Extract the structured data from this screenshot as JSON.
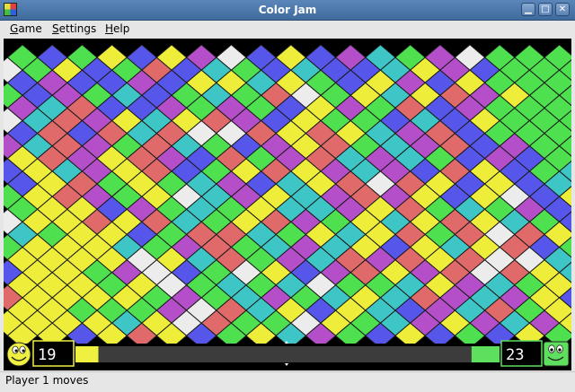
{
  "window": {
    "title": "Color Jam"
  },
  "menu": {
    "game": "Game",
    "settings": "Settings",
    "help": "Help"
  },
  "colors": {
    "background": "#000000",
    "tile_outline": "#1a1a1a",
    "palette": {
      "G": "#4ee04e",
      "B": "#5656ea",
      "Y": "#eded3a",
      "W": "#ececec",
      "C": "#3ec6c6",
      "P": "#b54fc9",
      "R": "#e06a6a"
    },
    "player1": "#f0f040",
    "player2": "#5ee05e",
    "progress_track": "#3c3c3c"
  },
  "board": {
    "cols": 19,
    "rows": 12,
    "offset_rows": [
      "GBGYBYPWBYBPCGPWGGG",
      "BPBBPBYYCYGBYPBYGGG",
      "PCRBBPGPGBYPGRBPGGG",
      "BRBRCRWWRYRYCPRBGGG",
      "YRPYRPBRGPRCPCGBPBG",
      "BYRGYGCPBCYRWRYBYBC",
      "GYYBPGCGYCCPYRGCGPB",
      "CGYYBGRRCGYCYRGRWRY",
      "YYYYWYCRGPCRPRYRWWC",
      "YYYGYWGCGCWGGCYPCGY",
      "YYGGGPWRCYBYCBPCRGY",
      "YYBYRYBGYCPGBYBGBYG"
    ],
    "between_rows": [
      "WGYBGRBCGBCBBCYPBGGG",
      "GBPGCBGCGRWGYCYRPYGG",
      "WCRPYCYRPBYGGBCBYGGG",
      "PCRPGRCGBPYRGCPRBPGG",
      "BYCPYRBGYRYPCPBRYBGC",
      "GYRPGYWCPYCPRPYBYWBY",
      "WYYRYRCGYRPGYCYRYCGB",
      "GYYYCGPRGCPCYBYCYRBG",
      "BYYGPWBGWYBPRYPRWRYC",
      "RYYYYGPGCPGCYCRPCPYB",
      "YYYYCYWRGGWYGCPYPCPY"
    ]
  },
  "players": {
    "player1": {
      "score": "19",
      "icon": "smiley-face-icon",
      "share": 0.054
    },
    "player2": {
      "score": "23",
      "icon": "smiley-face-icon",
      "share": 0.066
    }
  },
  "status": {
    "text": "Player 1 moves"
  }
}
